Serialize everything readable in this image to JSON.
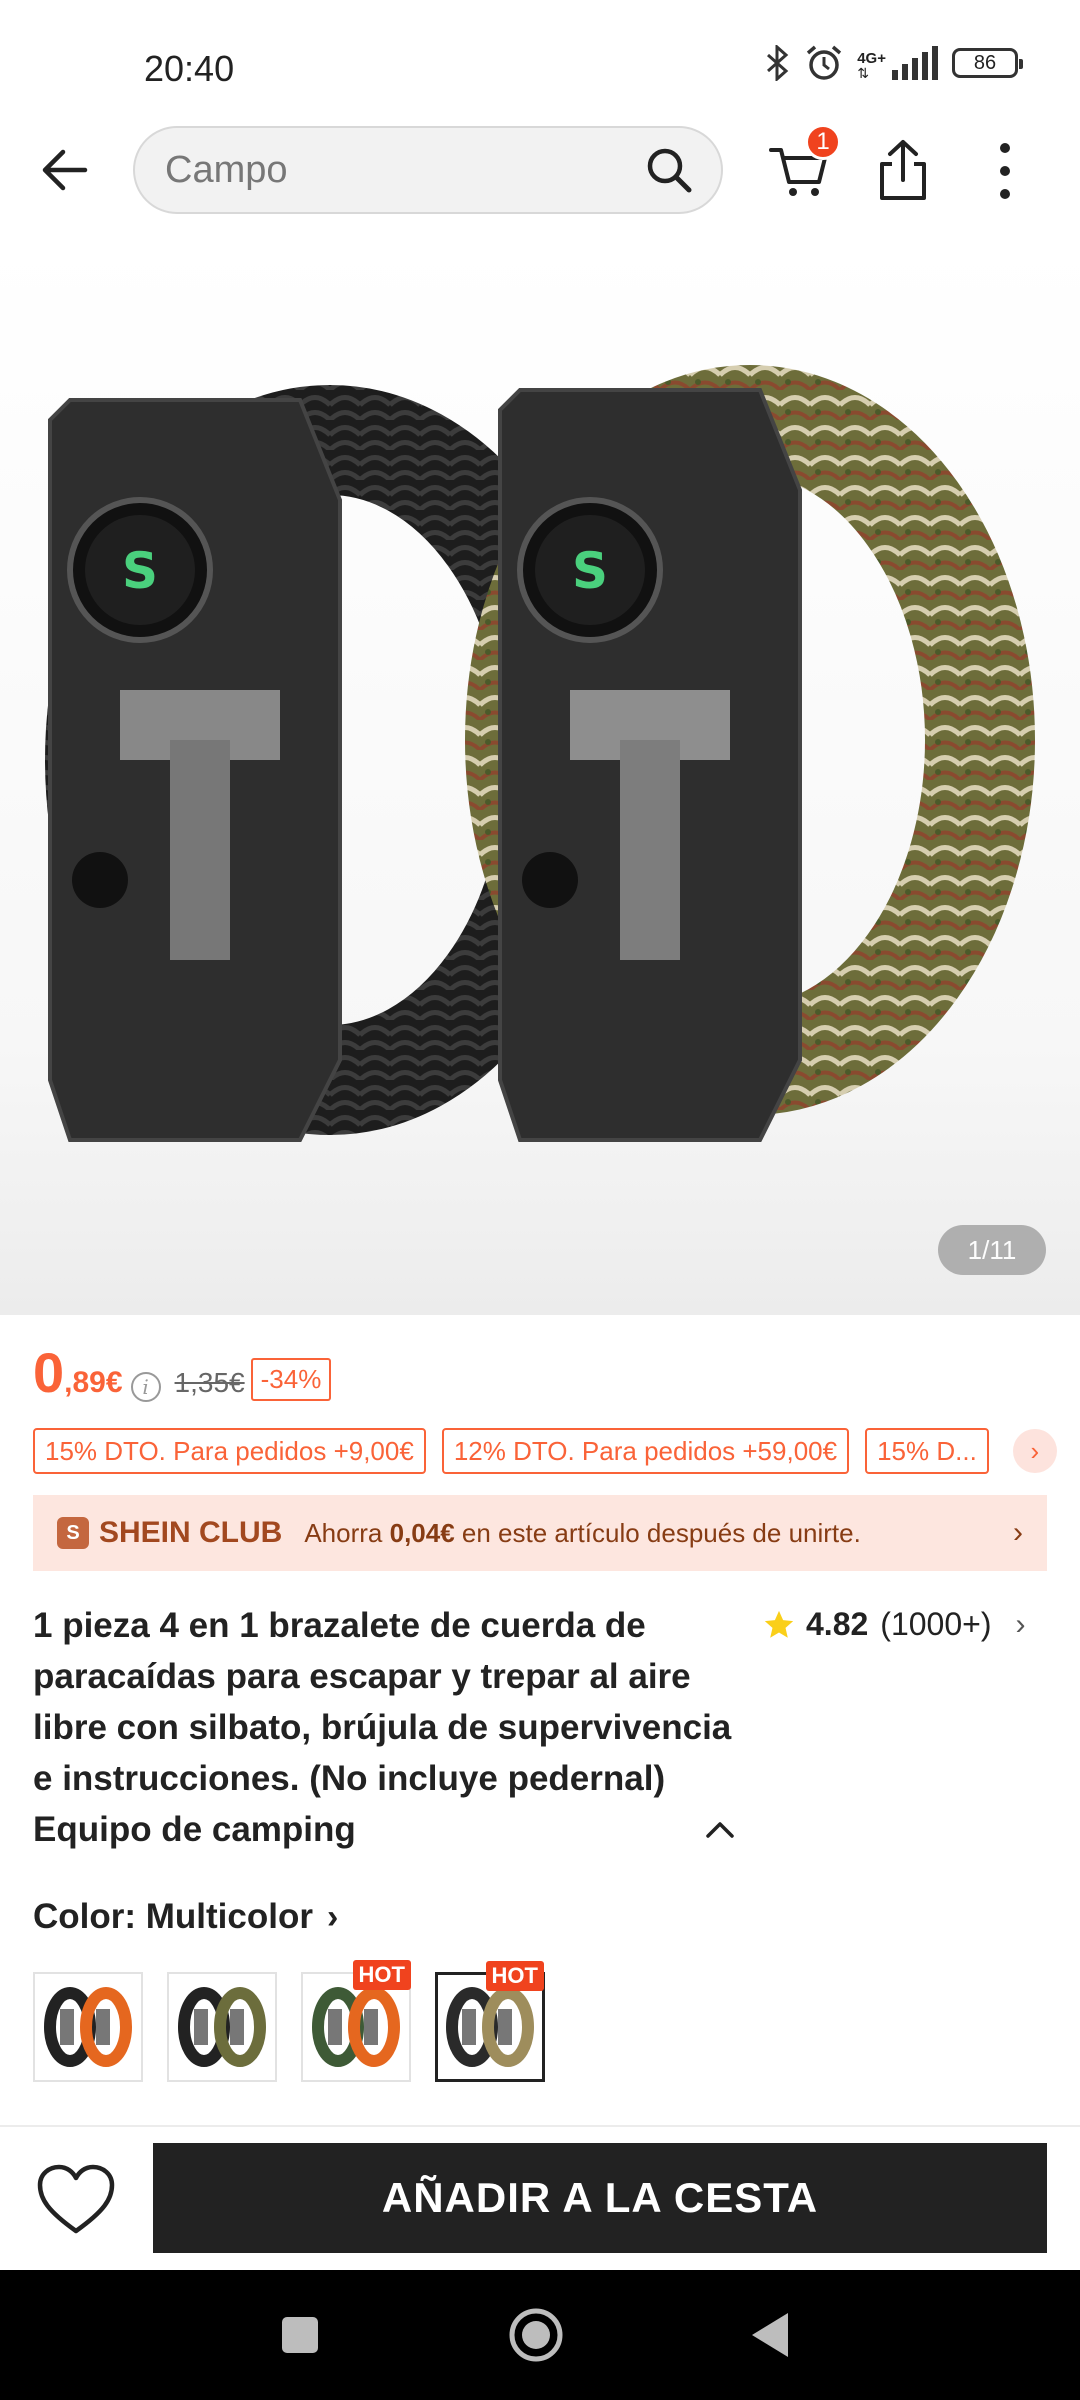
{
  "status_bar": {
    "time": "20:40",
    "network": "4G+",
    "battery": "86",
    "icons": [
      "bluetooth-icon",
      "alarm-icon",
      "signal-icon",
      "battery-icon"
    ]
  },
  "top_nav": {
    "search_placeholder": "Campo",
    "cart_count": "1",
    "icons": [
      "back-arrow-icon",
      "search-icon",
      "cart-icon",
      "share-icon",
      "more-vertical-icon"
    ]
  },
  "gallery": {
    "counter": "1/11"
  },
  "price": {
    "integer": "0",
    "decimal": ",89€",
    "info_symbol": "i",
    "original": "1,35€",
    "discount": "-34%"
  },
  "coupons": [
    "15% DTO. Para pedidos +9,00€",
    "12% DTO. Para pedidos +59,00€",
    "15% D..."
  ],
  "club": {
    "logo_letter": "S",
    "name": "SHEIN CLUB",
    "text_before": "Ahorra ",
    "amount": "0,04€",
    "text_after": " en este artículo después de unirte."
  },
  "product": {
    "title": "1 pieza 4 en 1 brazalete de cuerda de paracaídas para escapar y trepar al aire libre con silbato, brújula de supervivencia e instrucciones. (No incluye pedernal) Equipo de camping",
    "rating": "4.82",
    "rating_count": "(1000+)"
  },
  "color": {
    "label": "Color: Multicolor",
    "hot_label": "HOT",
    "swatches": [
      {
        "name": "black-orange",
        "hot": false,
        "selected": false
      },
      {
        "name": "black-olive",
        "hot": false,
        "selected": false
      },
      {
        "name": "camo-orange",
        "hot": true,
        "selected": false
      },
      {
        "name": "black-camo",
        "hot": true,
        "selected": true
      }
    ]
  },
  "actions": {
    "add_to_cart": "AÑADIR A LA CESTA"
  },
  "colors": {
    "accent": "#fa6338",
    "badge": "#f0431e",
    "club_bg": "#fde6df",
    "button_bg": "#222222"
  }
}
